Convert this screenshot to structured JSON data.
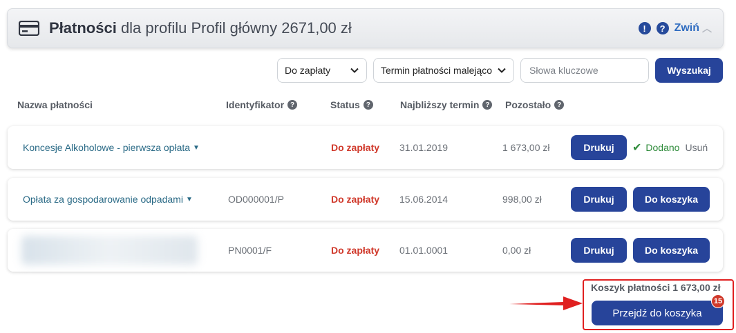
{
  "header": {
    "title_bold": "Płatności",
    "title_rest": "dla profilu Profil główny 2671,00 zł",
    "info_icon": "exclamation-icon",
    "help_icon": "question-icon",
    "collapse_label": "Zwiń",
    "card_icon": "credit-card-icon"
  },
  "filters": {
    "status_select": "Do zapłaty",
    "sort_select": "Termin płatności malejąco",
    "search_placeholder": "Słowa kluczowe",
    "search_button": "Wyszukaj"
  },
  "columns": {
    "name": "Nazwa płatności",
    "identifier": "Identyfikator",
    "status": "Status",
    "due": "Najbliższy termin",
    "remaining": "Pozostało",
    "help_glyph": "?"
  },
  "rows": [
    {
      "name": "Koncesje Alkoholowe - pierwsza opłata",
      "identifier": "",
      "status": "Do zapłaty",
      "due": "31.01.2019",
      "remaining": "1 673,00 zł",
      "print_label": "Drukuj",
      "added_label": "Dodano",
      "remove_label": "Usuń"
    },
    {
      "name": "Opłata za gospodarowanie odpadami",
      "identifier": "OD000001/P",
      "status": "Do zapłaty",
      "due": "15.06.2014",
      "remaining": "998,00 zł",
      "print_label": "Drukuj",
      "cart_label": "Do koszyka"
    },
    {
      "name": "",
      "identifier": "PN0001/F",
      "status": "Do zapłaty",
      "due": "01.01.0001",
      "remaining": "0,00 zł",
      "print_label": "Drukuj",
      "cart_label": "Do koszyka"
    }
  ],
  "cart": {
    "total_label": "Koszyk płatności 1 673,00 zł",
    "go_button": "Przejdź do koszyka",
    "badge_count": "15"
  },
  "colors": {
    "primary": "#27449a",
    "status_red": "#d0392b",
    "link": "#2a6a86",
    "added_green": "#2e8b3a",
    "highlight": "#e02020"
  }
}
